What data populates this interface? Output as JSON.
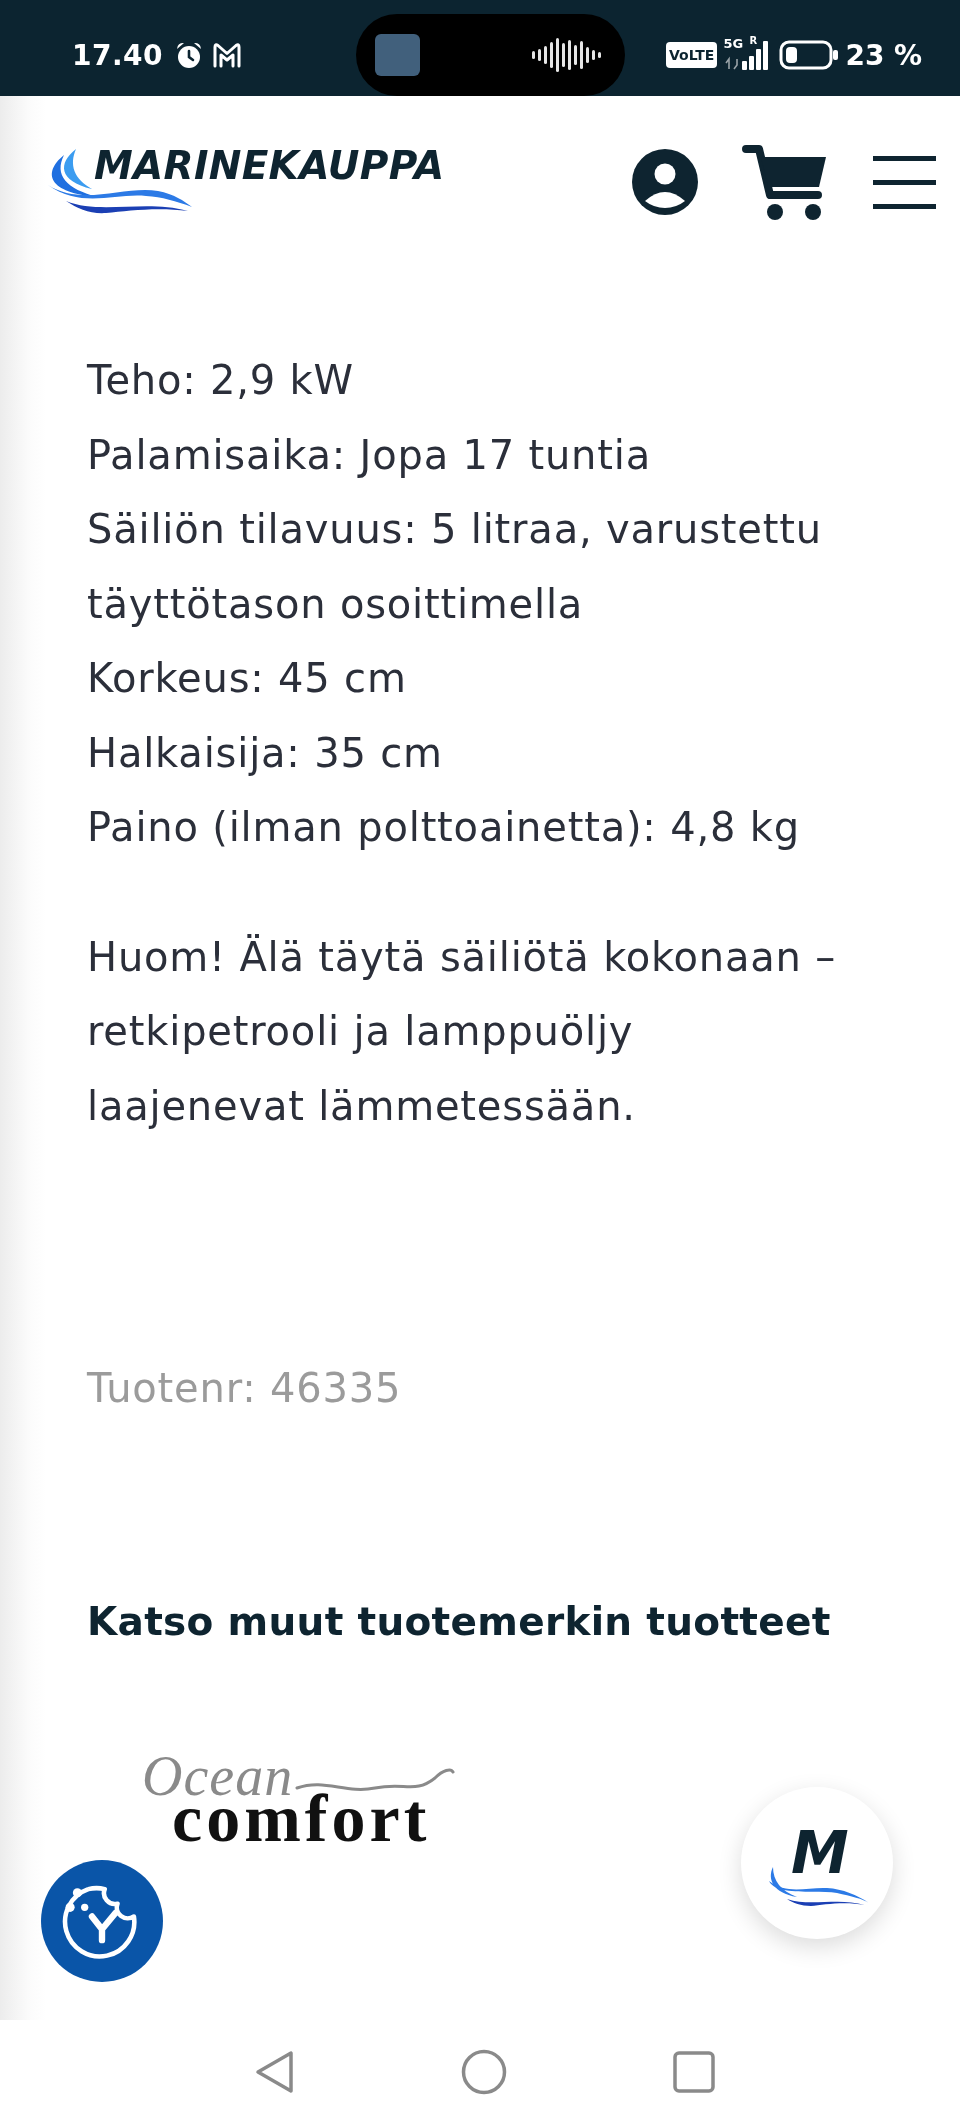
{
  "status_bar": {
    "time": "17.40",
    "network_badge": "VoLTE",
    "network_type": "5G",
    "roaming": "R",
    "battery": "23 %"
  },
  "header": {
    "logo": "MARINEKAUPPA"
  },
  "specs": [
    "Teho: 2,9 kW",
    "Palamisaika: Jopa 17 tuntia",
    "Säiliön tilavuus: 5 litraa, varustettu täyttötason osoittimella",
    "Korkeus: 45 cm",
    "Halkaisija: 35 cm",
    "Paino (ilman polttoainetta): 4,8 kg"
  ],
  "note": {
    "lines": [
      "Huom! Älä täytä säiliötä kokonaan –",
      "retkipetrooli ja lamppuöljy",
      "laajenevat lämmetessään."
    ]
  },
  "product_number": "Tuotenr: 46335",
  "brand_section": {
    "heading": "Katso muut tuotemerkin tuotteet",
    "brand_logo": {
      "script": "Ocean",
      "main": "comfort"
    }
  },
  "chat_button": {
    "letter": "M"
  }
}
